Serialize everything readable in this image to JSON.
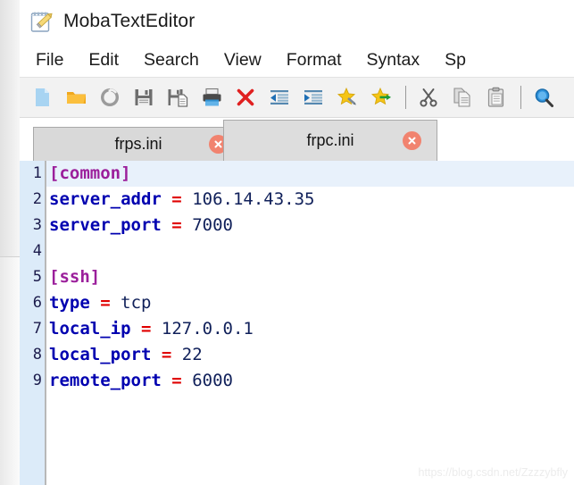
{
  "window": {
    "title": "MobaTextEditor",
    "icon": "notepad-pencil-icon"
  },
  "menubar": {
    "items": [
      {
        "label": "File",
        "name": "menu-file"
      },
      {
        "label": "Edit",
        "name": "menu-edit"
      },
      {
        "label": "Search",
        "name": "menu-search"
      },
      {
        "label": "View",
        "name": "menu-view"
      },
      {
        "label": "Format",
        "name": "menu-format"
      },
      {
        "label": "Syntax",
        "name": "menu-syntax"
      },
      {
        "label": "Sp",
        "name": "menu-special"
      }
    ]
  },
  "toolbar": {
    "buttons": [
      {
        "name": "new-file-icon",
        "tip": "New"
      },
      {
        "name": "open-folder-icon",
        "tip": "Open"
      },
      {
        "name": "reload-icon",
        "tip": "Reload"
      },
      {
        "name": "save-icon",
        "tip": "Save"
      },
      {
        "name": "save-as-icon",
        "tip": "Save As"
      },
      {
        "name": "print-icon",
        "tip": "Print"
      },
      {
        "name": "close-document-icon",
        "tip": "Close"
      },
      {
        "name": "outdent-icon",
        "tip": "Decrease Indent"
      },
      {
        "name": "indent-icon",
        "tip": "Increase Indent"
      },
      {
        "name": "bookmark-toggle-icon",
        "tip": "Toggle Bookmark"
      },
      {
        "name": "bookmark-next-icon",
        "tip": "Next Bookmark"
      },
      {
        "name": "cut-icon",
        "tip": "Cut"
      },
      {
        "name": "copy-icon",
        "tip": "Copy"
      },
      {
        "name": "paste-icon",
        "tip": "Paste"
      },
      {
        "name": "find-icon",
        "tip": "Find"
      }
    ]
  },
  "tabs": [
    {
      "label": "frps.ini",
      "active": false,
      "close_icon": "close-icon"
    },
    {
      "label": "frpc.ini",
      "active": true,
      "close_icon": "close-icon"
    }
  ],
  "editor": {
    "active_file": "frpc.ini",
    "current_line": 1,
    "lines": [
      {
        "no": "1",
        "section": "[common]"
      },
      {
        "no": "2",
        "key": "server_addr",
        "eq": "=",
        "value": "106.14.43.35"
      },
      {
        "no": "3",
        "key": "server_port",
        "eq": "=",
        "value": "7000"
      },
      {
        "no": "4"
      },
      {
        "no": "5",
        "section": "[ssh]"
      },
      {
        "no": "6",
        "key": "type",
        "eq": "=",
        "value": "tcp"
      },
      {
        "no": "7",
        "key": "local_ip",
        "eq": "=",
        "value": "127.0.0.1"
      },
      {
        "no": "8",
        "key": "local_port",
        "eq": "=",
        "value": "22"
      },
      {
        "no": "9",
        "key": "remote_port",
        "eq": "=",
        "value": "6000"
      }
    ]
  },
  "watermark": {
    "text": "https://blog.csdn.net/Zzzzybfly"
  },
  "colors": {
    "section": "#9b1f9b",
    "key": "#0000b0",
    "equals": "#e00000",
    "value": "#10205a",
    "gutter_bg": "#dcebf9",
    "current_line_bg": "#e8f1fb",
    "tab_close": "#f1836f",
    "toolbar_bg": "#f2f2f2"
  }
}
